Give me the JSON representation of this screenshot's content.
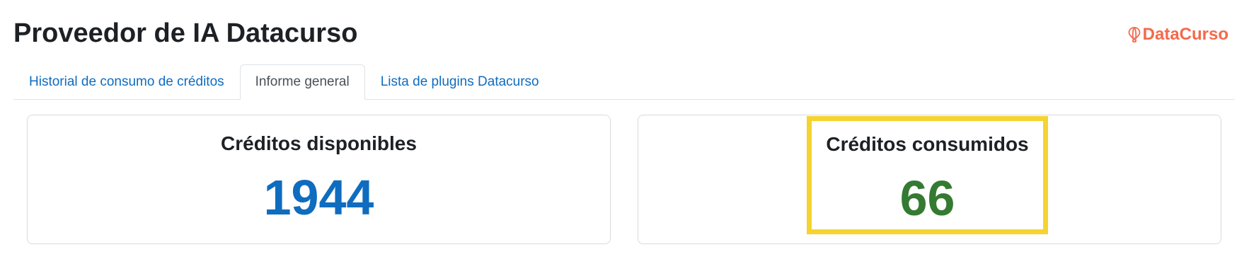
{
  "header": {
    "title": "Proveedor de IA Datacurso",
    "brand_name": "DataCurso",
    "brand_icon": "hot-air-balloon-icon",
    "brand_color": "#f4694a"
  },
  "tabs": [
    {
      "label": "Historial de consumo de créditos",
      "active": false
    },
    {
      "label": "Informe general",
      "active": true
    },
    {
      "label": "Lista de plugins Datacurso",
      "active": false
    }
  ],
  "cards": {
    "available": {
      "title": "Créditos disponibles",
      "value": "1944",
      "color": "#0f6cbf"
    },
    "consumed": {
      "title": "Créditos consumidos",
      "value": "66",
      "color": "#357a32",
      "highlight_color": "#f5d331"
    }
  }
}
